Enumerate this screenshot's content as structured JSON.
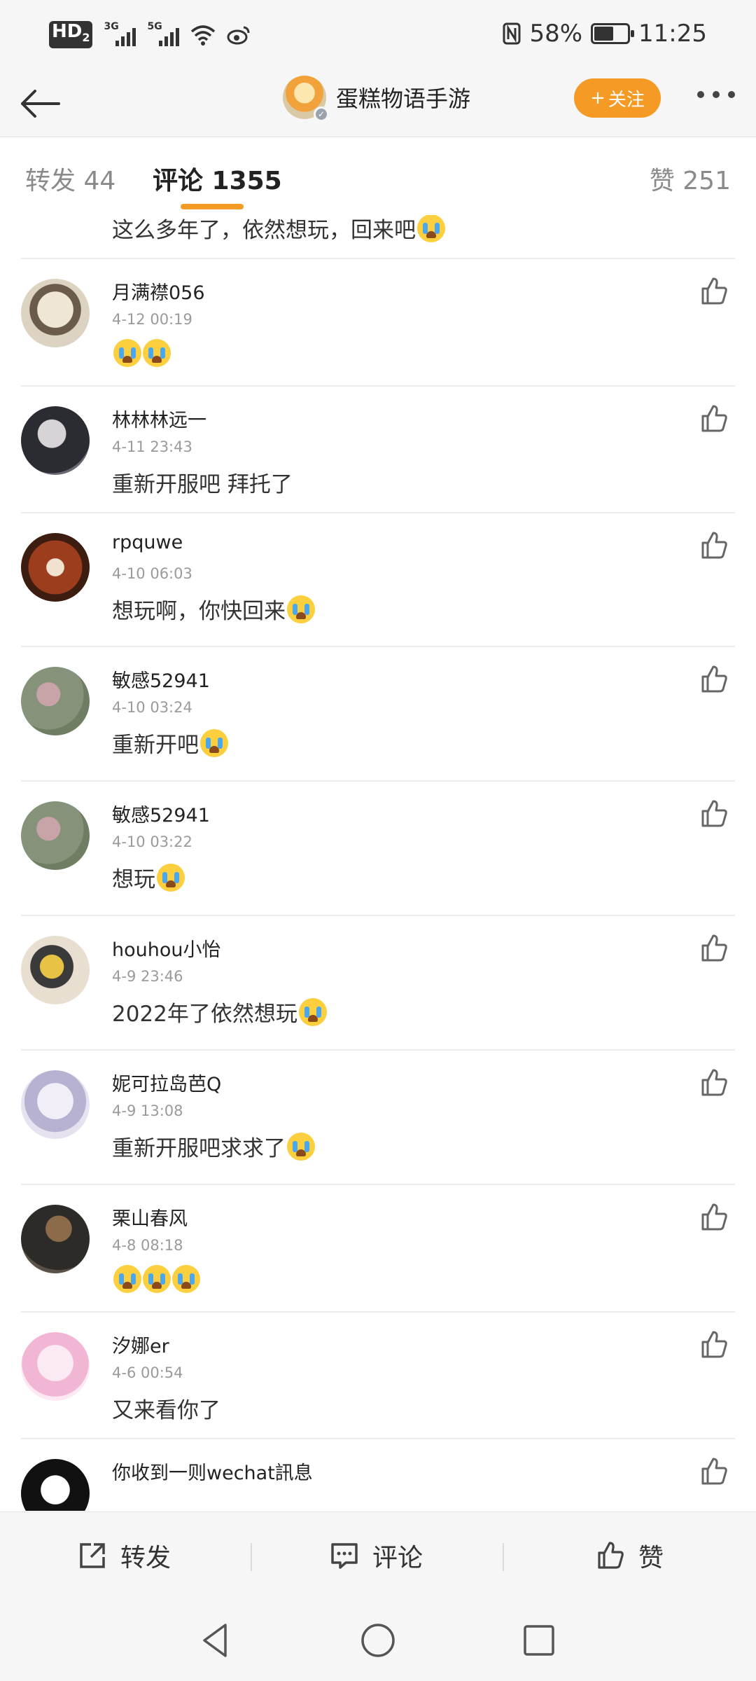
{
  "status_bar": {
    "hd_label": "HD",
    "hd_sub": "2",
    "net1_label": "3G",
    "net2_label": "5G",
    "battery_percent_text": "58%",
    "battery_level": 0.58,
    "time": "11:25",
    "icons": [
      "hd-icon",
      "signal-3g-icon",
      "signal-5g-icon",
      "wifi-icon",
      "weibo-icon",
      "nfc-icon",
      "battery-icon"
    ]
  },
  "header": {
    "account_name": "蛋糕物语手游",
    "follow_label": "关注",
    "follow_plus": "+"
  },
  "tabs": [
    {
      "label": "转发 44"
    },
    {
      "label": "评论 1355"
    },
    {
      "label": "赞 251"
    }
  ],
  "partial_comment": {
    "text": "这么多年了，依然想玩，回来吧"
  },
  "comments": [
    {
      "user": "月满襟056",
      "time": "4-12 00:19",
      "text": "",
      "emoji_count": 2
    },
    {
      "user": "林林林远一",
      "time": "4-11 23:43",
      "text": "重新开服吧 拜托了",
      "emoji_count": 0
    },
    {
      "user": "rpquwe",
      "time": "4-10 06:03",
      "text": "想玩啊，你快回来",
      "emoji_count": 1
    },
    {
      "user": "敏感52941",
      "time": "4-10 03:24",
      "text": "重新开吧",
      "emoji_count": 1
    },
    {
      "user": "敏感52941",
      "time": "4-10 03:22",
      "text": "想玩",
      "emoji_count": 1
    },
    {
      "user": "houhou小怡",
      "time": "4-9 23:46",
      "text": "2022年了依然想玩",
      "emoji_count": 1
    },
    {
      "user": "妮可拉岛芭Q",
      "time": "4-9 13:08",
      "text": "重新开服吧求求了",
      "emoji_count": 1
    },
    {
      "user": "栗山春风",
      "time": "4-8 08:18",
      "text": "",
      "emoji_count": 3
    },
    {
      "user": "汐娜er",
      "time": "4-6 00:54",
      "text": "又来看你了",
      "emoji_count": 0
    },
    {
      "user": "你收到一则wechat訊息",
      "time": "",
      "text": "",
      "emoji_count": 0
    }
  ],
  "bottom_bar": {
    "repost_label": "转发",
    "comment_label": "评论",
    "like_label": "赞"
  },
  "colors": {
    "accent": "#f59b25",
    "bg_bar": "#f6f6f6",
    "text_primary": "#222222",
    "text_secondary": "#9a9a9a"
  }
}
